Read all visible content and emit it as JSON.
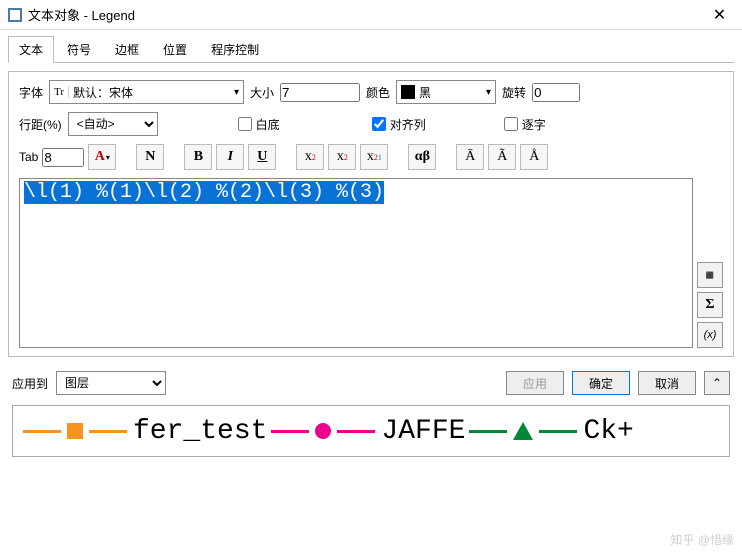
{
  "window": {
    "title": "文本对象 - Legend"
  },
  "tabs": {
    "t1": "文本",
    "t2": "符号",
    "t3": "边框",
    "t4": "位置",
    "t5": "程序控制"
  },
  "font": {
    "label": "字体",
    "prefix": "Tr",
    "value": "默认：宋体",
    "sizeLabel": "大小",
    "sizeValue": "7",
    "colorLabel": "颜色",
    "colorValue": "黑",
    "rotateLabel": "旋转",
    "rotateValue": "0"
  },
  "line": {
    "spacingLabel": "行距(%)",
    "spacingValue": "<自动>",
    "whiteBg": "白底",
    "alignCols": "对齐列",
    "perChar": "逐字"
  },
  "tab": {
    "label": "Tab",
    "value": "8"
  },
  "buttons": {
    "normal": "N",
    "bold": "B",
    "italic": "I",
    "underline": "U",
    "sup": "x",
    "supExp": "2",
    "sub": "x",
    "subIdx": "2",
    "supsub": "x",
    "supsubA": "2",
    "supsubB": "1",
    "greek": "αβ",
    "Abar": "Ā",
    "Atilde": "Ã",
    "Adot": "Å"
  },
  "text": {
    "content": "\\l(1) %(1)\\l(2) %(2)\\l(3) %(3)"
  },
  "side": {
    "sym": "◾",
    "sigma": "Σ",
    "var": "(x)"
  },
  "bottom": {
    "applyToLabel": "应用到",
    "applyToValue": "图层",
    "apply": "应用",
    "ok": "确定",
    "cancel": "取消",
    "collapse": "⌃"
  },
  "legend": {
    "a": "fer_test",
    "b": "JAFFE",
    "c": "Ck+"
  },
  "watermark": "知乎 @惜缘"
}
